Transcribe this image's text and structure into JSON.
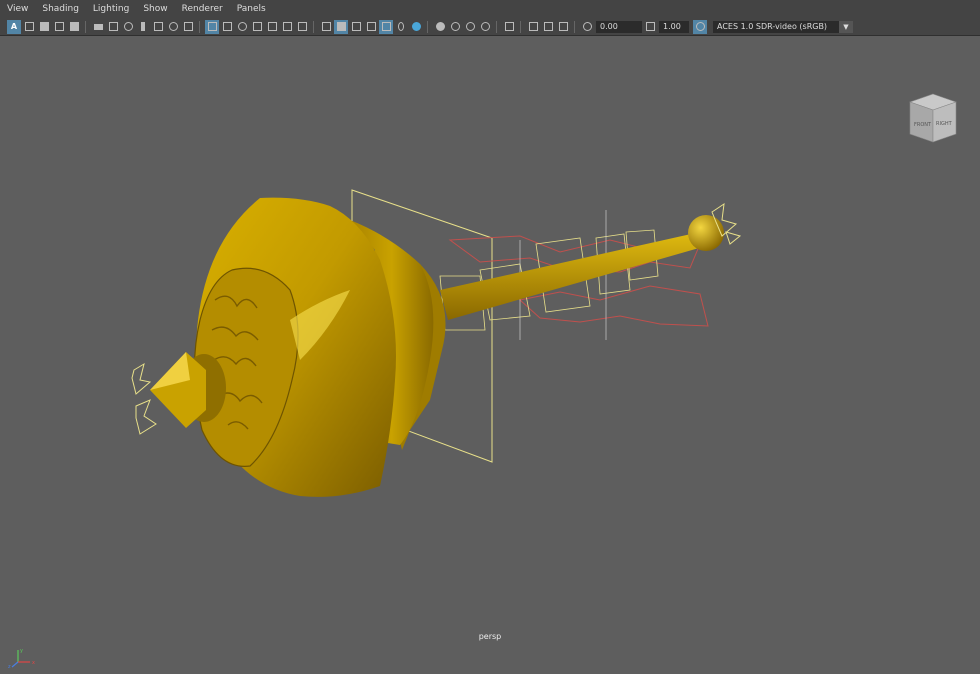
{
  "menu": {
    "items": [
      "View",
      "Shading",
      "Lighting",
      "Show",
      "Renderer",
      "Panels"
    ]
  },
  "toolbar": {
    "exposure_value": "0.00",
    "gamma_value": "1.00",
    "color_space": "ACES 1.0 SDR-video (sRGB)",
    "icons": [
      "select-camera",
      "camera-attributes",
      "bookmarks",
      "image-plane",
      "grid",
      "film-gate",
      "resolution-gate",
      "gate-mask",
      "field-chart",
      "safe-action",
      "safe-title",
      "wireframe",
      "smooth-shade-all",
      "wireframe-on-shaded",
      "textured",
      "use-all-lights",
      "shadows",
      "screen-space-ao",
      "motion-blur",
      "multisample-aa",
      "depth-of-field",
      "isolate-select",
      "xray",
      "xray-active-components",
      "xray-joints",
      "exposure",
      "gamma",
      "color-management"
    ]
  },
  "viewcube": {
    "front_label": "FRONT",
    "right_label": "RIGHT"
  },
  "viewport": {
    "camera_label": "persp"
  },
  "axis": {
    "x": "x",
    "y": "y",
    "z": "z"
  },
  "colors": {
    "gold": "#c8a000",
    "gold_dark": "#7a5f00",
    "wire_yellow": "#e8e08a",
    "wire_red": "#c0504d",
    "viewport_bg": "#5e5e5e"
  }
}
